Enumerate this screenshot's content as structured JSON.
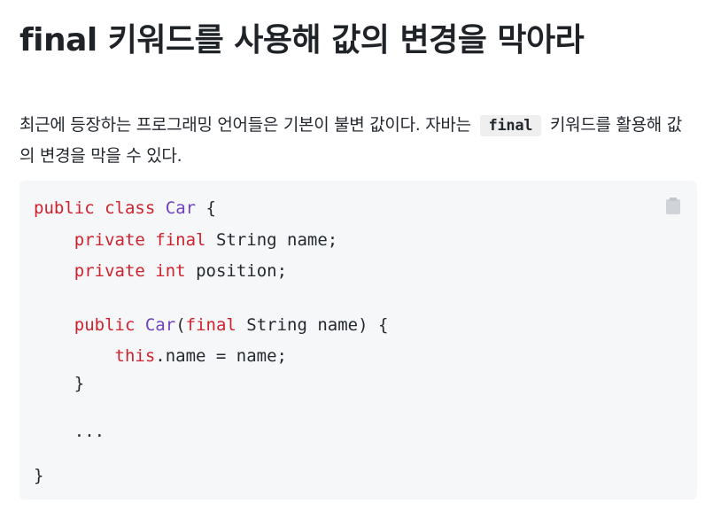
{
  "article": {
    "title": "final 키워드를 사용해 값의 변경을 막아라",
    "paragraph": {
      "text_before": "최근에 등장하는 프로그래밍 언어들은 기본이 불변 값이다. 자바는",
      "inline_code": "final",
      "text_after": "키워드를 활용해 값의 변경을 막을 수 있다."
    },
    "code": {
      "copy_icon": "clipboard-icon",
      "line1": {
        "kw1": "public",
        "kw2": "class",
        "cls": "Car",
        "rest": "{"
      },
      "line2": {
        "kw1": "private",
        "kw2": "final",
        "rest": "String name;"
      },
      "line3": {
        "kw1": "private",
        "kw2": "int",
        "rest": "position;"
      },
      "line5": {
        "kw1": "public",
        "cls": "Car",
        "paren": "(",
        "kw2": "final",
        "rest": "String name) {"
      },
      "line6": {
        "kw": "this",
        "rest": ".name = name;"
      },
      "line7": "}",
      "line8": "...",
      "line9": "}"
    }
  },
  "colors": {
    "keyword": "#cf222e",
    "class_name": "#6f42c1",
    "code_background": "#f6f7f8"
  }
}
